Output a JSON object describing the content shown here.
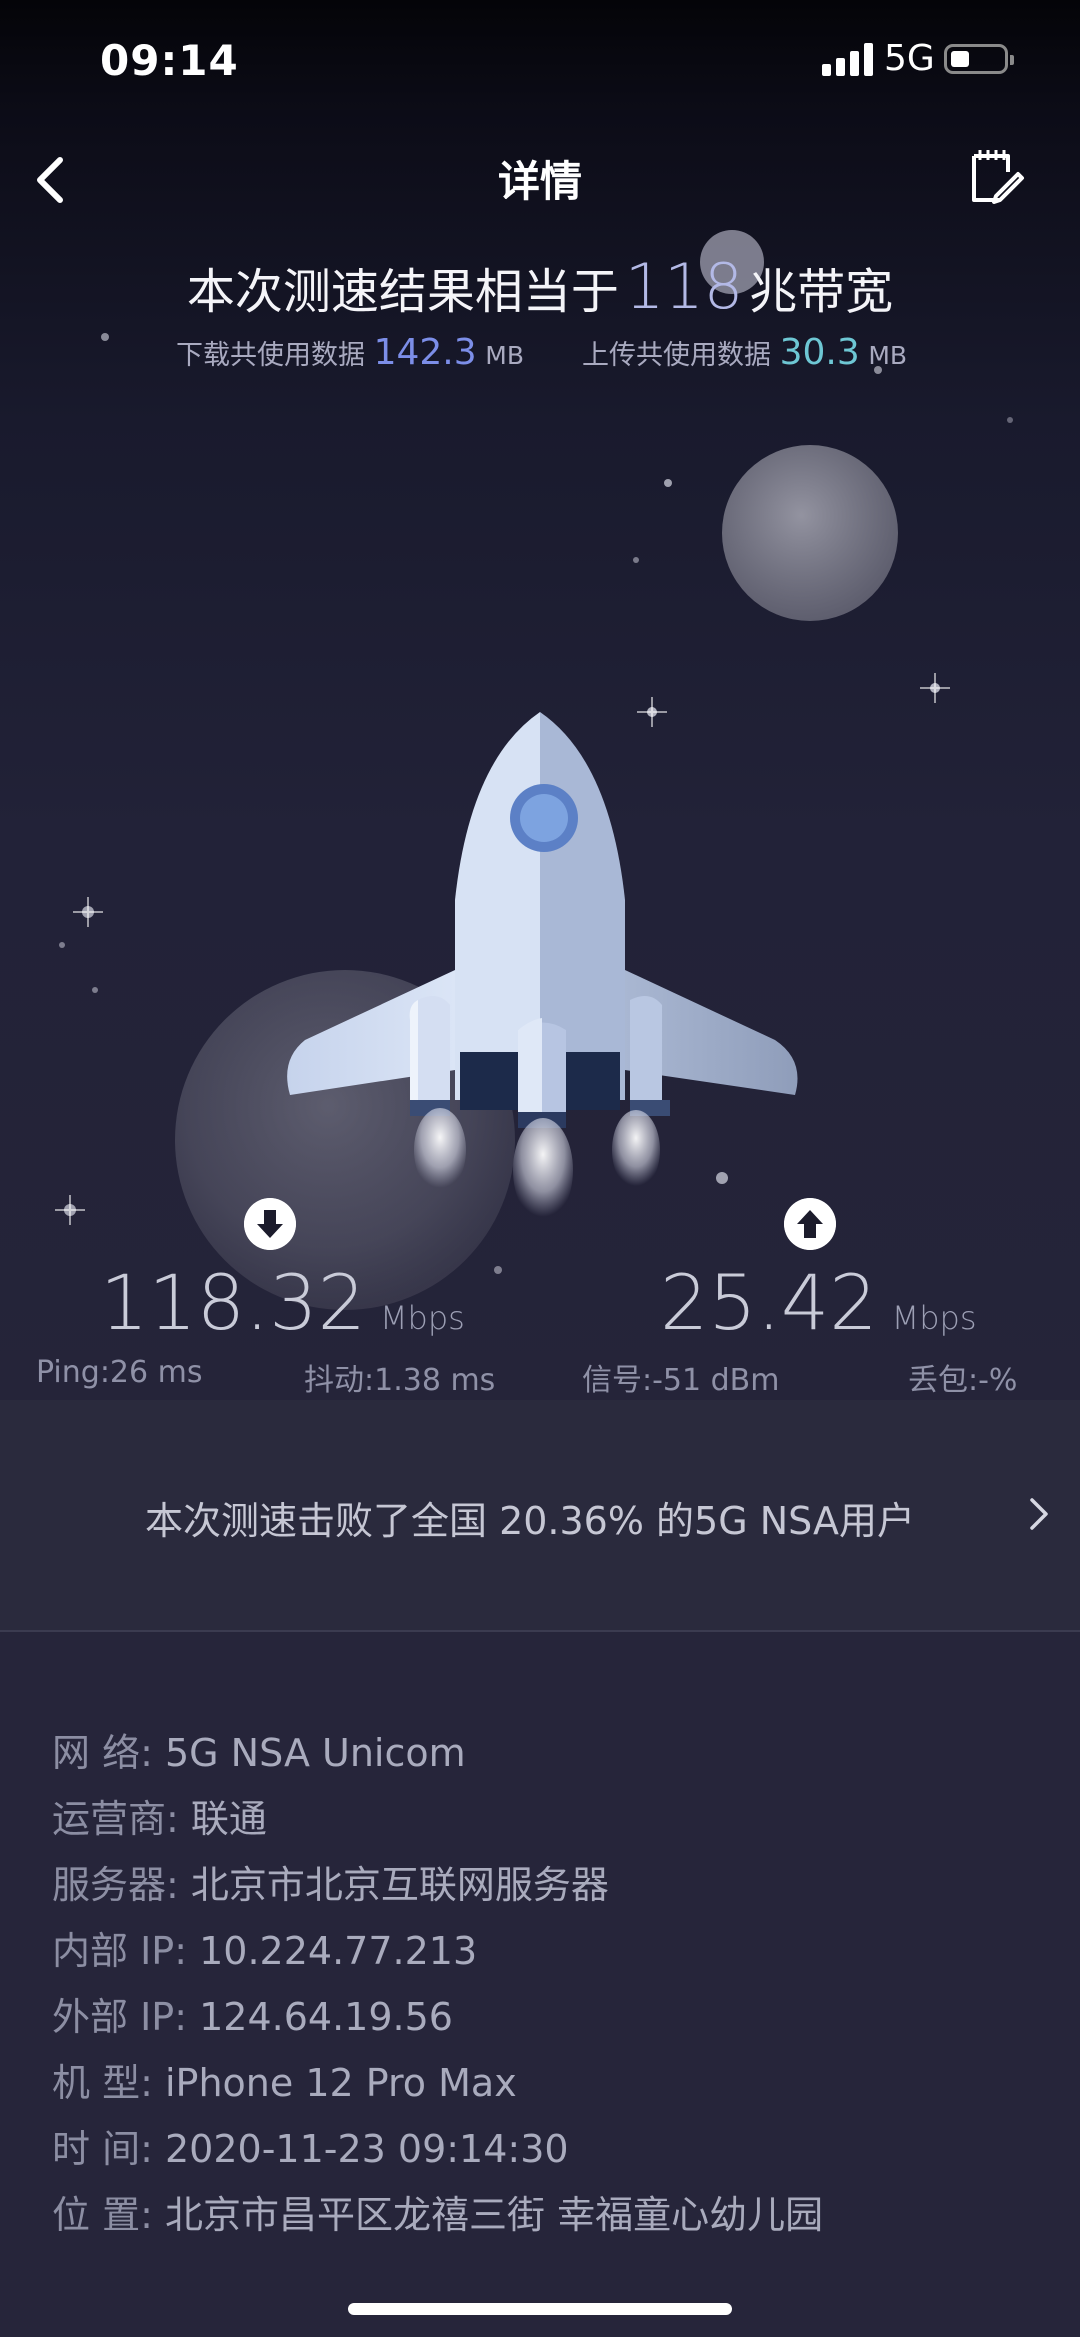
{
  "status_bar": {
    "time": "09:14",
    "network": "5G"
  },
  "nav": {
    "title": "详情"
  },
  "summary": {
    "prefix": "本次测速结果相当于",
    "bandwidth": "118",
    "suffix": "兆带宽",
    "download_label": "下载共使用数据",
    "download_value": "142.3",
    "download_unit": "MB",
    "upload_label": "上传共使用数据",
    "upload_value": "30.3",
    "upload_unit": "MB"
  },
  "speeds": {
    "download": {
      "value": "118.32",
      "unit": "Mbps",
      "icon": "arrow-down-icon"
    },
    "upload": {
      "value": "25.42",
      "unit": "Mbps",
      "icon": "arrow-up-icon"
    }
  },
  "metrics": {
    "ping": "Ping:26 ms",
    "jitter": "抖动:1.38 ms",
    "signal": "信号:-51 dBm",
    "loss": "丢包:-%"
  },
  "ranking": {
    "text": "本次测速击败了全国 20.36% 的5G NSA用户"
  },
  "info": [
    {
      "label": "网 络:",
      "value": "5G NSA Unicom"
    },
    {
      "label": "运营商:",
      "value": "联通"
    },
    {
      "label": "服务器:",
      "value": "北京市北京互联网服务器"
    },
    {
      "label": "内部 IP:",
      "value": "10.224.77.213"
    },
    {
      "label": "外部 IP:",
      "value": "124.64.19.56"
    },
    {
      "label": "机 型:",
      "value": "iPhone 12 Pro Max"
    },
    {
      "label": "时 间:",
      "value": "2020-11-23 09:14:30"
    },
    {
      "label": "位 置:",
      "value": "北京市昌平区龙禧三街 幸福童心幼儿园"
    }
  ],
  "colors": {
    "background": "#26253a",
    "download_accent": "#7c8ee8",
    "upload_accent": "#6ec7d4",
    "rocket_body": "#bfd0ec"
  }
}
